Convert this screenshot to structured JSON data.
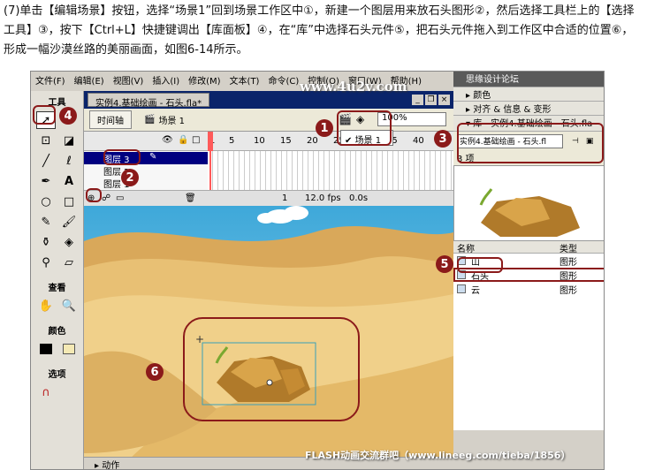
{
  "instruction": "(7)单击【编辑场景】按钮，选择“场景1”回到场景工作区中①，新建一个图层用来放石头图形②，然后选择工具栏上的【选择工具】③，按下【Ctrl+L】快捷键调出【库面板】④，在“库”中选择石头元件⑤，把石头元件拖入到工作区中合适的位置⑥，形成一幅沙漠丝路的美丽画面，如图6-14所示。",
  "menus": [
    "文件(F)",
    "编辑(E)",
    "视图(V)",
    "插入(I)",
    "修改(M)",
    "文本(T)",
    "命令(C)",
    "控制(O)",
    "窗口(W)",
    "帮助(H)"
  ],
  "toolbox": {
    "title": "工具",
    "view_label": "查看",
    "colors_label": "颜色",
    "options_label": "选项"
  },
  "document": {
    "tab": "实例4.基础绘画 - 石头.fla*",
    "timeline_button": "时间轴",
    "scene": "场景 1",
    "zoom": "100%",
    "scene_menu_item": "场景 1"
  },
  "timeline": {
    "frames": [
      "1",
      "5",
      "10",
      "15",
      "20",
      "25",
      "30",
      "35",
      "40"
    ],
    "layers": [
      "图层 3",
      "图层 2",
      "图层 1"
    ],
    "current_frame": "1",
    "fps": "12.0 fps",
    "time": "0.0s"
  },
  "panels": {
    "watermark_top": "思缘设计论坛",
    "color_panel": "颜色",
    "align_panel": "对齐 & 信息 & 变形",
    "library_title": "库 - 实例4.基础绘画 - 石头.fla",
    "library_select": "实例4.基础绘画 - 石头.fl",
    "item_count": "3 项",
    "col_name": "名称",
    "col_type": "类型",
    "items": [
      {
        "name": "山",
        "type": "图形"
      },
      {
        "name": "石头",
        "type": "图形"
      },
      {
        "name": "云",
        "type": "图形"
      }
    ]
  },
  "motion_label": "动作",
  "watermarks": {
    "site": "www.4u2v.com",
    "footer": "FLASH动画交流群吧（www.lineeg.com/tieba/1856）"
  },
  "badges": [
    "1",
    "2",
    "3",
    "4",
    "5",
    "6"
  ],
  "colors": {
    "accent": "#8b1a1a",
    "sand": "#e4c06a",
    "sky": "#5ab6e0"
  }
}
